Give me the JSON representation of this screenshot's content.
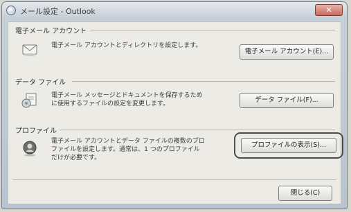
{
  "window": {
    "title": "メール設定 - Outlook",
    "close_glyph": "✕"
  },
  "groups": [
    {
      "label": "電子メール アカウント",
      "icon": "email-account-icon",
      "description": [
        "電子メール アカウントとディレクトリを設定します。"
      ],
      "button": "電子メール アカウント(E)..."
    },
    {
      "label": "データ ファイル",
      "icon": "data-file-icon",
      "description": [
        "電子メール メッセージとドキュメントを保存するため",
        "に使用するファイルの設定を変更します。"
      ],
      "button": "データ ファイル(F)..."
    },
    {
      "label": "プロファイル",
      "icon": "profile-icon",
      "description": [
        "電子メール アカウントとデータ ファイルの複数のプロ",
        "ファイルを設定します。通常は、1 つのプロファイル",
        "だけが必要です。"
      ],
      "button": "プロファイルの表示(S)..."
    }
  ],
  "footer": {
    "close_button": "閉じる(C)"
  }
}
